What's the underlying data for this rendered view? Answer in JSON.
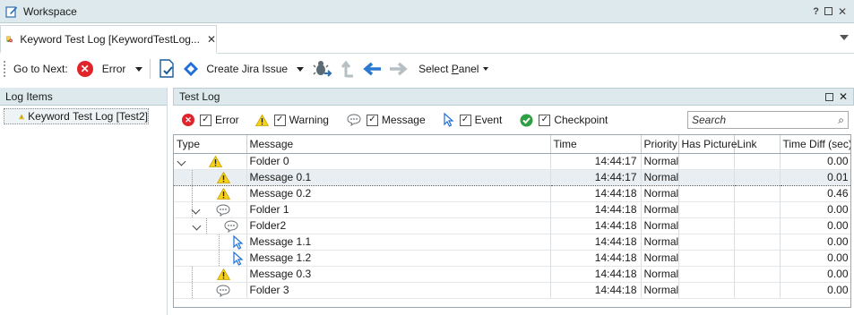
{
  "workspace": {
    "title": "Workspace",
    "help": "?"
  },
  "tab": {
    "label": "Keyword Test Log [KeywordTestLog...",
    "close": "✕"
  },
  "toolbar": {
    "goto_label": "Go to Next:",
    "error_label": "Error",
    "jira_label": "Create Jira Issue",
    "select_panel_pre": "Select ",
    "select_panel_u": "P",
    "select_panel_post": "anel"
  },
  "left_panel": {
    "title": "Log Items",
    "item": "Keyword Test Log [Test2]"
  },
  "right_panel": {
    "title": "Test Log",
    "filters": [
      {
        "label": "Error",
        "checked": true,
        "icon": "error-icon"
      },
      {
        "label": "Warning",
        "checked": true,
        "icon": "warning-icon"
      },
      {
        "label": "Message",
        "checked": true,
        "icon": "message-icon"
      },
      {
        "label": "Event",
        "checked": true,
        "icon": "event-icon"
      },
      {
        "label": "Checkpoint",
        "checked": true,
        "icon": "checkpoint-icon"
      }
    ],
    "search_placeholder": "Search",
    "columns": [
      "Type",
      "Message",
      "Time",
      "Priority",
      "Has Picture",
      "Link",
      "Time Diff (sec)"
    ],
    "rows": [
      {
        "depth": 0,
        "expander": true,
        "icon": "warning",
        "message": "Folder 0",
        "time": "14:44:17",
        "priority": "Normal",
        "diff": "0.00",
        "selected": false
      },
      {
        "depth": 1,
        "expander": false,
        "icon": "warning",
        "message": "Message 0.1",
        "time": "14:44:17",
        "priority": "Normal",
        "diff": "0.01",
        "selected": true
      },
      {
        "depth": 1,
        "expander": false,
        "icon": "warning",
        "message": "Message 0.2",
        "time": "14:44:18",
        "priority": "Normal",
        "diff": "0.46",
        "selected": false
      },
      {
        "depth": 1,
        "expander": true,
        "icon": "message",
        "message": "Folder 1",
        "time": "14:44:18",
        "priority": "Normal",
        "diff": "0.00",
        "selected": false
      },
      {
        "depth": 2,
        "expander": true,
        "icon": "message",
        "message": "Folder2",
        "time": "14:44:18",
        "priority": "Normal",
        "diff": "0.00",
        "selected": false
      },
      {
        "depth": 3,
        "expander": false,
        "icon": "event",
        "message": "Message 1.1",
        "time": "14:44:18",
        "priority": "Normal",
        "diff": "0.00",
        "selected": false
      },
      {
        "depth": 3,
        "expander": false,
        "icon": "event",
        "message": "Message 1.2",
        "time": "14:44:18",
        "priority": "Normal",
        "diff": "0.00",
        "selected": false
      },
      {
        "depth": 1,
        "expander": false,
        "icon": "warning",
        "message": "Message 0.3",
        "time": "14:44:18",
        "priority": "Normal",
        "diff": "0.00",
        "selected": false
      },
      {
        "depth": 1,
        "expander": false,
        "icon": "message",
        "message": "Folder 3",
        "time": "14:44:18",
        "priority": "Normal",
        "diff": "0.00",
        "selected": false
      }
    ]
  }
}
